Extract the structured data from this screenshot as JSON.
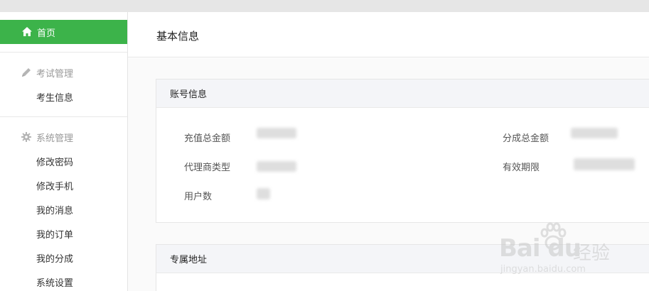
{
  "sidebar": {
    "home": {
      "label": "首页",
      "icon": "home-icon",
      "active_color": "#3cb34a"
    },
    "exam_group": {
      "title": "考试管理",
      "icon": "pencil-icon",
      "items": [
        {
          "label": "考生信息"
        }
      ]
    },
    "system_group": {
      "title": "系统管理",
      "icon": "gear-icon",
      "items": [
        {
          "label": "修改密码"
        },
        {
          "label": "修改手机"
        },
        {
          "label": "我的消息"
        },
        {
          "label": "我的订单"
        },
        {
          "label": "我的分成"
        },
        {
          "label": "系统设置"
        }
      ]
    }
  },
  "main": {
    "title": "基本信息",
    "account_card": {
      "title": "账号信息",
      "fields": {
        "recharge_total": {
          "label": "充值总金额"
        },
        "share_total": {
          "label": "分成总金额"
        },
        "agent_type": {
          "label": "代理商类型"
        },
        "validity": {
          "label": "有效期限"
        },
        "user_count": {
          "label": "用户数"
        }
      }
    },
    "address_card": {
      "title": "专属地址"
    }
  },
  "watermark": {
    "brand": "Bai du",
    "suffix": "经验",
    "url": "jingyan.baidu.com"
  }
}
